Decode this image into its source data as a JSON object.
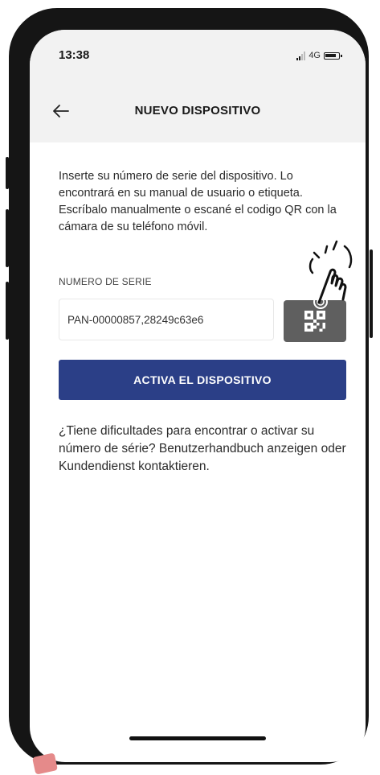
{
  "status_bar": {
    "time": "13:38",
    "network": "4G",
    "icons": [
      "signal-icon",
      "battery-icon"
    ]
  },
  "header": {
    "title": "NUEVO DISPOSITIVO",
    "back_icon": "arrow-left-icon"
  },
  "main": {
    "intro": "Inserte su número de serie del dispositivo. Lo encontrará en su manual de usuario o etiqueta. Escríbalo manualmente o escané el codigo QR con la cámara de su teléfono móvil.",
    "serial_label": "NUMERO DE SERIE",
    "serial_value": "PAN-00000857,28249c63e6",
    "qr_icon": "qr-code-icon",
    "activate_button": "ACTIVA EL DISPOSITIVO",
    "help_text": "¿Tiene dificultades para encontrar o activar su número de série? Benutzerhandbuch anzeigen oder Kundendienst kontaktieren."
  },
  "colors": {
    "header_bg": "#f2f2f2",
    "primary_button": "#2b3f87",
    "qr_button": "#5f5f5f",
    "phone_frame": "#151515"
  },
  "overlay": {
    "pointer_icon": "hand-pointer-icon"
  }
}
